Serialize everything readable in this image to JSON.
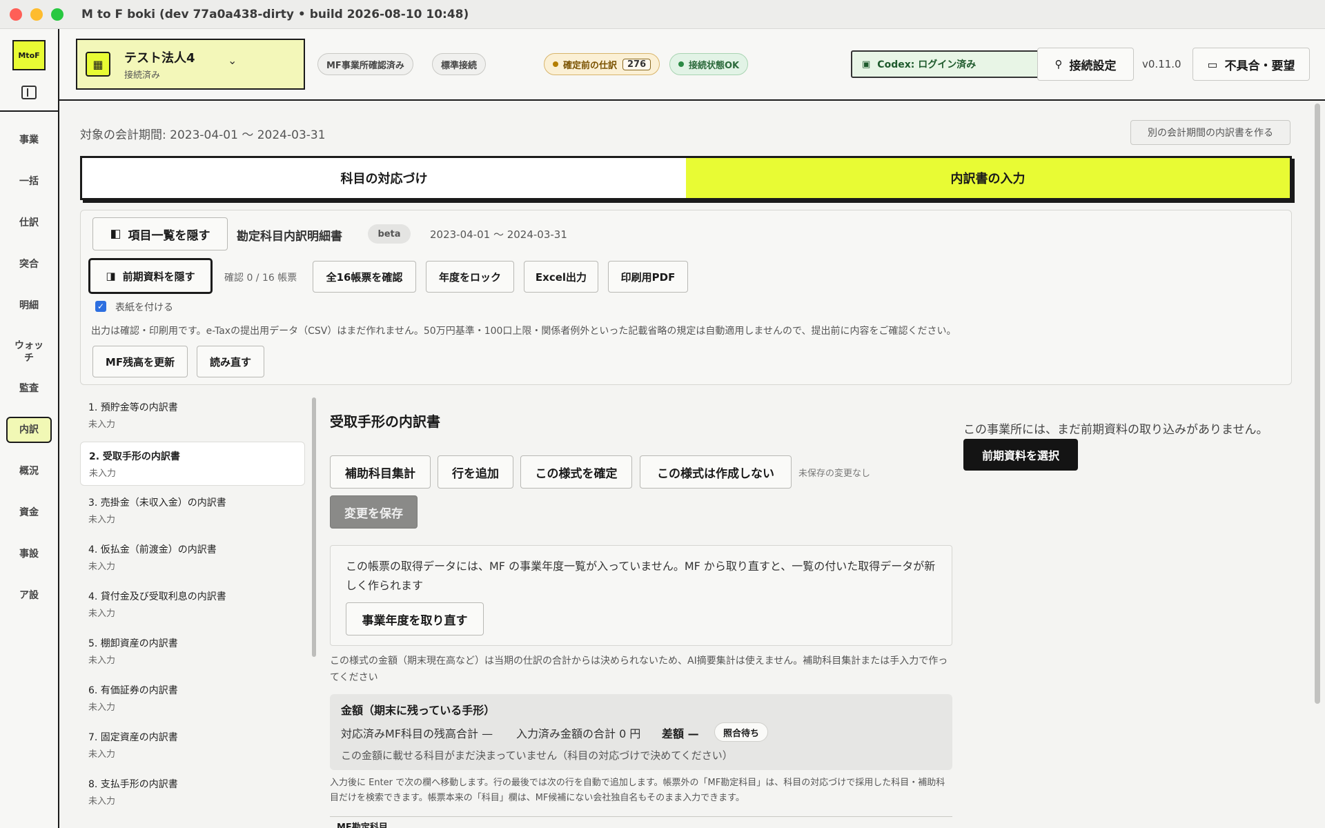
{
  "window": {
    "title": "M to F boki (dev 77a0a438-dirty • build 2026-08-10 10:48)"
  },
  "rail": {
    "logo": "MtoF",
    "items": [
      "事業",
      "一括",
      "仕訳",
      "突合",
      "明細",
      "ウォッ\nチ",
      "監査",
      "内訳",
      "概況",
      "資金",
      "事設",
      "ア設"
    ]
  },
  "header": {
    "company_name": "テスト法人4",
    "company_status": "接続済み",
    "pill_mf": "MF事業所確認済み",
    "pill_standard": "標準接続",
    "pending_label": "確定前の仕訳",
    "pending_count": "276",
    "connection_ok": "接続状態OK",
    "codex": "Codex: ログイン済み",
    "settings_button": "接続設定",
    "version": "v0.11.0",
    "feedback_button": "不具合・要望"
  },
  "main": {
    "period_label": "対象の会計期間: 2023-04-01 〜 2024-03-31",
    "other_period_button": "別の会計期間の内訳書を作る",
    "tabs": [
      "科目の対応づけ",
      "内訳書の入力"
    ],
    "toolbar": {
      "hide_list_button": "項目一覧を隠す",
      "doc_title": "勘定科目内訳明細書",
      "beta": "beta",
      "doc_period": "2023-04-01 〜 2024-03-31",
      "hide_prev_button": "前期資料を隠す",
      "confirm_status": "確認 0 / 16 帳票",
      "confirm_all_button": "全16帳票を確認",
      "lock_year_button": "年度をロック",
      "excel_button": "Excel出力",
      "pdf_button": "印刷用PDF",
      "cover_checkbox": "表紙を付ける",
      "disclaimer": "出力は確認・印刷用です。e-Taxの提出用データ（CSV）はまだ作れません。50万円基準・100口上限・関係者例外といった記載省略の規定は自動適用しませんので、提出前に内容をご確認ください。",
      "refresh_mf_button": "MF残高を更新",
      "reload_button": "読み直す"
    },
    "list": [
      {
        "title": "1. 預貯金等の内訳書",
        "status": "未入力"
      },
      {
        "title": "2. 受取手形の内訳書",
        "status": "未入力"
      },
      {
        "title": "3. 売掛金（未収入金）の内訳書",
        "status": "未入力"
      },
      {
        "title": "4. 仮払金（前渡金）の内訳書",
        "status": "未入力"
      },
      {
        "title": "4. 貸付金及び受取利息の内訳書",
        "status": "未入力"
      },
      {
        "title": "5. 棚卸資産の内訳書",
        "status": "未入力"
      },
      {
        "title": "6. 有価証券の内訳書",
        "status": "未入力"
      },
      {
        "title": "7. 固定資産の内訳書",
        "status": "未入力"
      },
      {
        "title": "8. 支払手形の内訳書",
        "status": "未入力"
      }
    ],
    "content": {
      "heading": "受取手形の内訳書",
      "sub_aggregate_button": "補助科目集計",
      "add_row_button": "行を追加",
      "confirm_format_button": "この様式を確定",
      "skip_format_button": "この様式は作成しない",
      "unsaved_note": "未保存の変更なし",
      "save_button": "変更を保存",
      "notice": "この帳票の取得データには、MF の事業年度一覧が入っていません。MF から取り直すと、一覧の付いた取得データが新しく作られます",
      "refetch_button": "事業年度を取り直す",
      "ai_note": "この様式の金額（期末現在高など）は当期の仕訳の合計からは決められないため、AI摘要集計は使えません。補助科目集計または手入力で作ってください",
      "amount_title": "金額（期末に残っている手形）",
      "mf_total": "対応済みMF科目の残高合計 —",
      "input_total": "入力済み金額の合計 0 円",
      "diff_label": "差額 —",
      "wait_badge": "照合待ち",
      "amount_note": "この金額に載せる科目がまだ決まっていません（科目の対応づけで決めてください）",
      "enter_note": "入力後に Enter で次の欄へ移動します。行の最後では次の行を自動で追加します。帳票外の「MF勘定科目」は、科目の対応づけで採用した科目・補助科目だけを検索できます。帳票本来の「科目」欄は、MF候補にない会社独自名もそのまま入力できます。",
      "table_col": "MF勘定科目"
    },
    "right": {
      "no_prev_msg": "この事業所には、まだ前期資料の取り込みがありません。",
      "select_prev_button": "前期資料を選択"
    }
  }
}
